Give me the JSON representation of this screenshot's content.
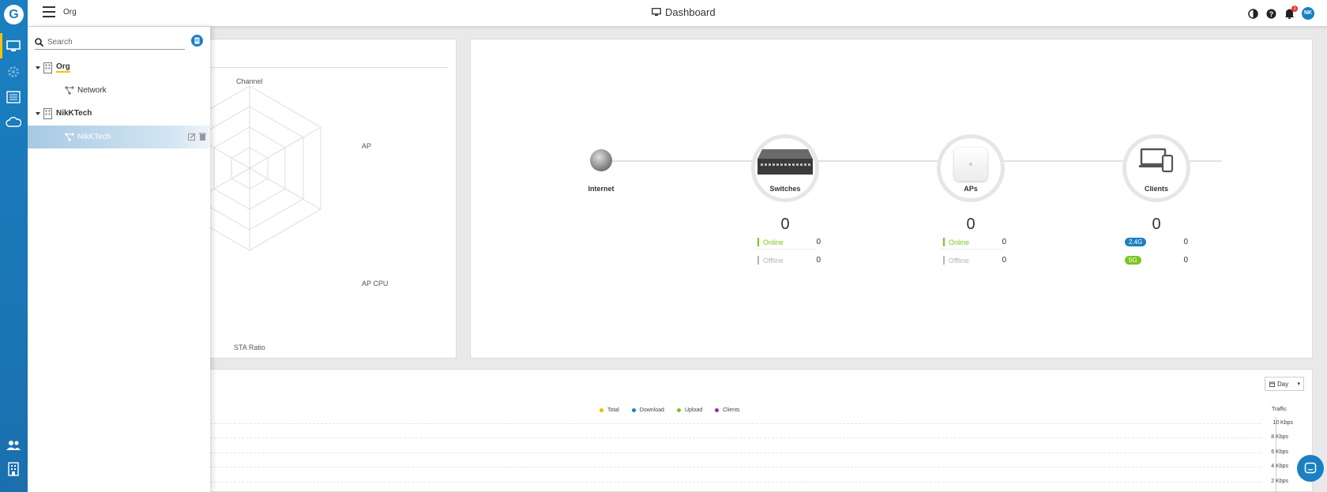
{
  "topbar": {
    "org_label": "Org",
    "title": "Dashboard",
    "notification_count": "1",
    "avatar_initials": "NK"
  },
  "search": {
    "placeholder": "Search"
  },
  "tree": [
    {
      "label": "Org",
      "type": "site"
    },
    {
      "label": "Network",
      "type": "network"
    },
    {
      "label": "NikKTech",
      "type": "site"
    },
    {
      "label": "NikKTech",
      "type": "network"
    }
  ],
  "radar": {
    "labels": [
      "Channel",
      "AP",
      "AP CPU",
      "STA Ratio"
    ]
  },
  "topology": {
    "internet_label": "Internet",
    "switches": {
      "label": "Switches",
      "count": "0",
      "online_label": "Online",
      "online": "0",
      "offline_label": "Offline",
      "offline": "0"
    },
    "aps": {
      "label": "APs",
      "count": "0",
      "online_label": "Online",
      "online": "0",
      "offline_label": "Offline",
      "offline": "0"
    },
    "clients": {
      "label": "Clients",
      "count": "0",
      "band1_label": "2.4G",
      "band1": "0",
      "band2_label": "5G",
      "band2": "0"
    }
  },
  "traffic": {
    "period": "Day",
    "legend": [
      "Total",
      "Download",
      "Upload",
      "Clients"
    ],
    "axis_title": "Traffic",
    "y_ticks": [
      "10 Kbps",
      "8 Kbps",
      "6 Kbps",
      "4 Kbps",
      "2 Kbps"
    ]
  },
  "colors": {
    "accent": "#1a80c2",
    "online": "#7cc520",
    "offline": "#b5b5b5",
    "total": "#f5b700",
    "download": "#1a80c2",
    "upload": "#7cc520",
    "clients": "#9c27b0"
  }
}
